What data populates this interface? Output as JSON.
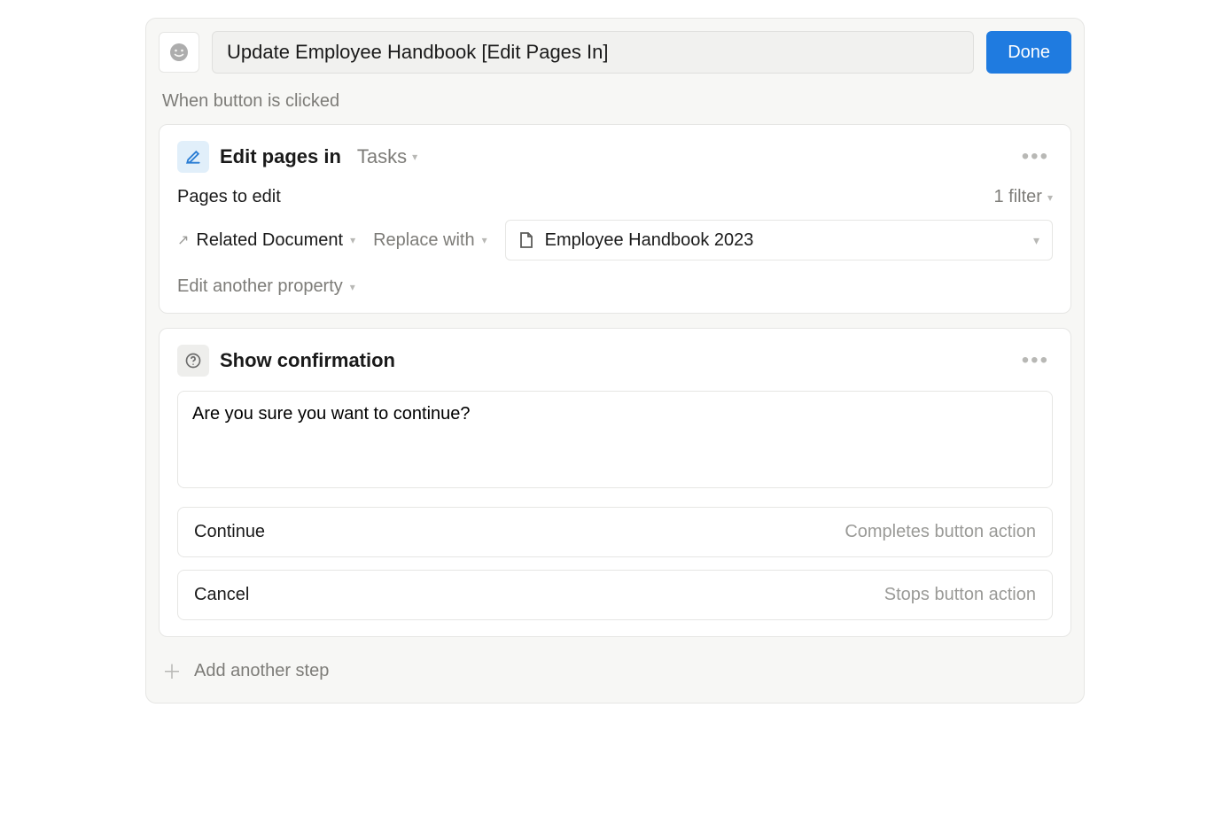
{
  "header": {
    "title_value": "Update Employee Handbook [Edit Pages In]",
    "done_label": "Done"
  },
  "trigger_label": "When button is clicked",
  "step1": {
    "title": "Edit pages in",
    "source": "Tasks",
    "pages_label": "Pages to edit",
    "filter_text": "1 filter",
    "property": "Related Document",
    "action": "Replace with",
    "value": "Employee Handbook 2023",
    "edit_another": "Edit another property"
  },
  "step2": {
    "title": "Show confirmation",
    "message": "Are you sure you want to continue?",
    "options": [
      {
        "label": "Continue",
        "hint": "Completes button action"
      },
      {
        "label": "Cancel",
        "hint": "Stops button action"
      }
    ]
  },
  "add_step_label": "Add another step"
}
